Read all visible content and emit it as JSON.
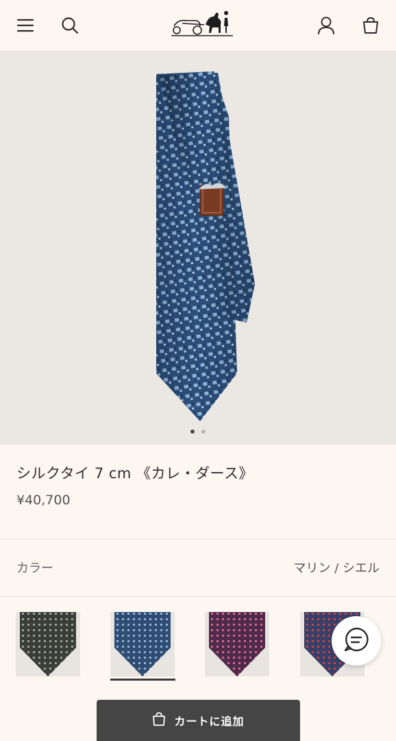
{
  "header": {
    "menu_icon": "hamburger-menu-icon",
    "search_icon": "search-icon",
    "logo": "hermes-carriage-logo",
    "account_icon": "user-icon",
    "cart_icon": "shopping-bag-icon"
  },
  "product": {
    "title": "シルクタイ 7 cm 《カレ・ダース》",
    "price": "¥40,700",
    "image_count": 2,
    "active_image": 1
  },
  "color": {
    "label": "カラー",
    "selected": "マリン / シエル"
  },
  "swatches": [
    {
      "name": "black-grey",
      "base": "#3a3d38",
      "accent": "#9aa39a",
      "selected": false
    },
    {
      "name": "marine-ciel",
      "base": "#2f4c72",
      "accent": "#8fb4d6",
      "selected": true
    },
    {
      "name": "purple-rose",
      "base": "#4e2a4c",
      "accent": "#d46a8a",
      "selected": false
    },
    {
      "name": "red-navy",
      "base": "#3a3f6a",
      "accent": "#c2473f",
      "selected": false
    }
  ],
  "chat_icon": "chat-bubble-icon",
  "cart_button": {
    "label": "カートに追加",
    "icon": "shopping-bag-icon"
  },
  "colors": {
    "background": "#fcf7f1",
    "hero_bg": "#ebe7e2",
    "button_bg": "#454545"
  }
}
